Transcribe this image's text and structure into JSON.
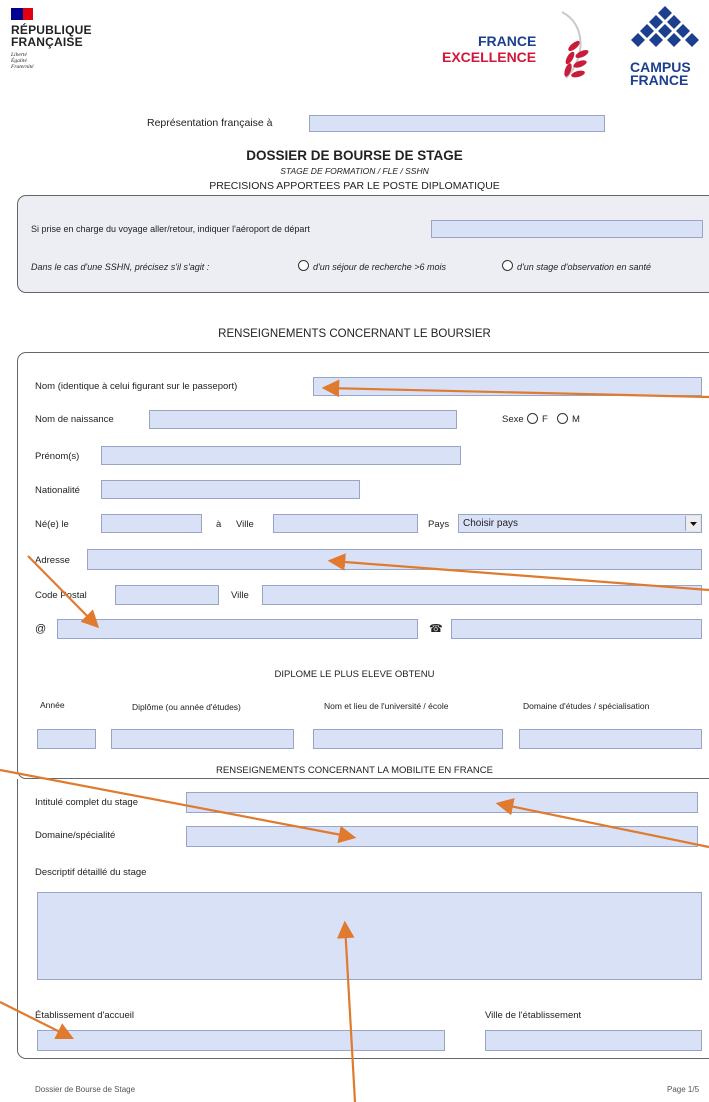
{
  "logos": {
    "rf_line1": "RÉPUBLIQUE",
    "rf_line2": "FRANÇAISE",
    "rf_motto1": "Liberté",
    "rf_motto2": "Égalité",
    "rf_motto3": "Fraternité",
    "fe_line1": "FRANCE",
    "fe_line2": "EXCELLENCE",
    "cf_line1": "CAMPUS",
    "cf_line2": "FRANCE"
  },
  "header": {
    "representation_label": "Représentation française à",
    "title": "DOSSIER DE BOURSE DE STAGE",
    "subtitle": "STAGE DE FORMATION / FLE / SSHN",
    "diplomatic_heading": "PRECISIONS APPORTEES PAR LE POSTE DIPLOMATIQUE"
  },
  "diplomatic": {
    "airport_label": "Si prise en charge du voyage aller/retour, indiquer l'aéroport de départ",
    "sshn_label": "Dans le cas d'une SSHN, précisez s'il s'agit :",
    "option1": "d'un séjour de recherche >6 mois",
    "option2": "d'un stage d'observation en santé"
  },
  "boursier": {
    "heading": "RENSEIGNEMENTS CONCERNANT LE BOURSIER",
    "nom_label": "Nom (identique à celui figurant sur le passeport)",
    "naissance_label": "Nom de naissance",
    "sexe_label": "Sexe",
    "sexe_f": "F",
    "sexe_m": "M",
    "prenom_label": "Prénom(s)",
    "nationalite_label": "Nationalité",
    "ne_label": "Né(e) le",
    "a_label": "à",
    "ville_label": "Ville",
    "pays_label": "Pays",
    "pays_value": "Choisir pays",
    "adresse_label": "Adresse",
    "cp_label": "Code Postal",
    "ville2_label": "Ville",
    "email_symbol": "@",
    "phone_symbol": "☎"
  },
  "diplome": {
    "heading": "DIPLOME LE PLUS ELEVE OBTENU",
    "col_annee": "Année",
    "col_diplome": "Diplôme (ou année d'études)",
    "col_univ": "Nom et lieu de l'université / école",
    "col_domaine": "Domaine d'études / spécialisation"
  },
  "mobilite": {
    "heading": "RENSEIGNEMENTS CONCERNANT LA MOBILITE EN FRANCE",
    "intitule_label": "Intitulé complet du stage",
    "domaine_label": "Domaine/spécialité",
    "descriptif_label": "Descriptif détaillé du stage",
    "etablissement_label": "Établissement d'accueil",
    "ville_etab_label": "Ville de l'établissement"
  },
  "footer": {
    "left": "Dossier de Bourse de Stage",
    "right": "Page 1/5"
  },
  "colors": {
    "field_fill": "#d9e1f7",
    "arrow": "#e07a2e",
    "rf_blue": "#000091",
    "rf_red": "#e1000f",
    "fe_red": "#d1183a",
    "laurel": "#c81d3a",
    "cf_blue": "#1d3f8f"
  }
}
